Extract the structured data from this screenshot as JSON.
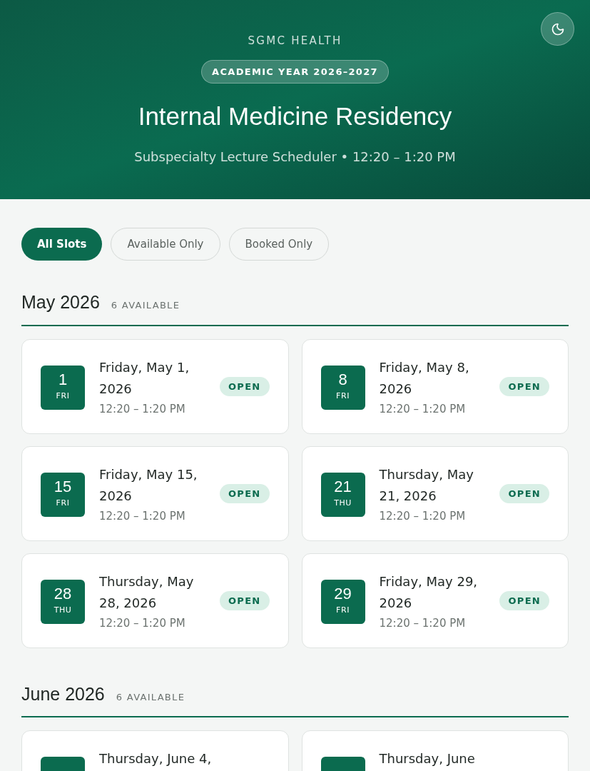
{
  "header": {
    "organization": "SGMC HEALTH",
    "year_badge": "ACADEMIC YEAR 2026–2027",
    "title": "Internal Medicine Residency",
    "subtitle": "Subspecialty Lecture Scheduler • 12:20 – 1:20 PM"
  },
  "filters": [
    {
      "label": "All Slots",
      "selected": true
    },
    {
      "label": "Available Only",
      "selected": false
    },
    {
      "label": "Booked Only",
      "selected": false
    }
  ],
  "months": [
    {
      "title": "May 2026",
      "count": "6 AVAILABLE",
      "slots": [
        {
          "day": "1",
          "weekday": "FRI",
          "date": "Friday, May 1, 2026",
          "time": "12:20 – 1:20 PM",
          "status": {
            "kind": "open",
            "label": "OPEN"
          }
        },
        {
          "day": "8",
          "weekday": "FRI",
          "date": "Friday, May 8, 2026",
          "time": "12:20 – 1:20 PM",
          "status": {
            "kind": "open",
            "label": "OPEN"
          }
        },
        {
          "day": "15",
          "weekday": "FRI",
          "date": "Friday, May 15, 2026",
          "time": "12:20 – 1:20 PM",
          "status": {
            "kind": "open",
            "label": "OPEN"
          }
        },
        {
          "day": "21",
          "weekday": "THU",
          "date": "Thursday, May 21, 2026",
          "time": "12:20 – 1:20 PM",
          "status": {
            "kind": "open",
            "label": "OPEN"
          }
        },
        {
          "day": "28",
          "weekday": "THU",
          "date": "Thursday, May 28, 2026",
          "time": "12:20 – 1:20 PM",
          "status": {
            "kind": "open",
            "label": "OPEN"
          }
        },
        {
          "day": "29",
          "weekday": "FRI",
          "date": "Friday, May 29, 2026",
          "time": "12:20 – 1:20 PM",
          "status": {
            "kind": "open",
            "label": "OPEN"
          }
        }
      ]
    },
    {
      "title": "June 2026",
      "count": "6 AVAILABLE",
      "slots": [
        {
          "date": "Thursday, June 4,"
        },
        {
          "date": "Thursday, June"
        }
      ]
    }
  ]
}
